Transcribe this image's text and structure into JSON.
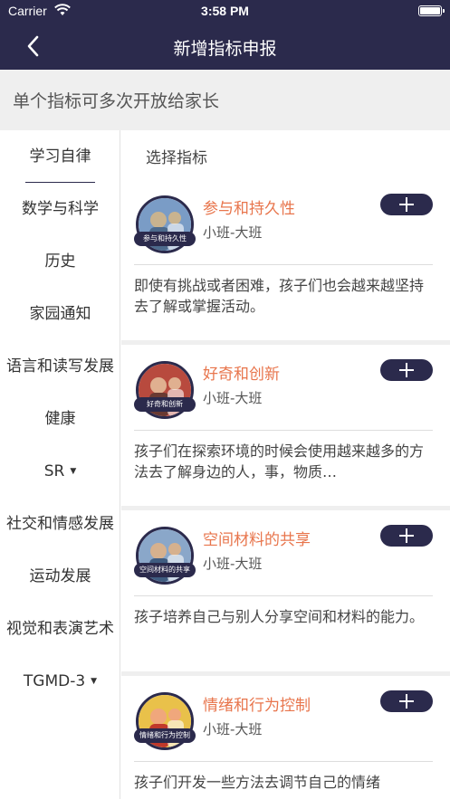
{
  "status_bar": {
    "carrier": "Carrier",
    "time": "3:58 PM"
  },
  "nav": {
    "title": "新增指标申报",
    "back_icon": "chevron-left-icon"
  },
  "notice": "单个指标可多次开放给家长",
  "sidebar": {
    "items": [
      {
        "label": "学习自律",
        "active": true,
        "dropdown": false
      },
      {
        "label": "数学与科学",
        "active": false,
        "dropdown": false
      },
      {
        "label": "历史",
        "active": false,
        "dropdown": false
      },
      {
        "label": "家园通知",
        "active": false,
        "dropdown": false
      },
      {
        "label": "语言和读写发展",
        "active": false,
        "dropdown": false
      },
      {
        "label": "健康",
        "active": false,
        "dropdown": false
      },
      {
        "label": "SR",
        "active": false,
        "dropdown": true
      },
      {
        "label": "社交和情感发展",
        "active": false,
        "dropdown": false
      },
      {
        "label": "运动发展",
        "active": false,
        "dropdown": false
      },
      {
        "label": "视觉和表演艺术",
        "active": false,
        "dropdown": false
      },
      {
        "label": "TGMD-3",
        "active": false,
        "dropdown": true
      }
    ],
    "dropdown_glyph": "▼"
  },
  "main": {
    "section_title": "选择指标",
    "cards": [
      {
        "name": "参与和持久性",
        "level": "小班-大班",
        "badge": "参与和持久性",
        "desc": "即使有挑战或者困难，孩子们也会越来越坚持去了解或掌握活动。"
      },
      {
        "name": "好奇和创新",
        "level": "小班-大班",
        "badge": "好奇和创新",
        "desc": "孩子们在探索环境的时候会使用越来越多的方法去了解身边的人，事，物质…"
      },
      {
        "name": "空间材料的共享",
        "level": "小班-大班",
        "badge": "空间材料的共享",
        "desc": "孩子培养自己与别人分享空间和材料的能力。"
      },
      {
        "name": "情绪和行为控制",
        "level": "小班-大班",
        "badge": "情绪和行为控制",
        "desc": "孩子们开发一些方法去调节自己的情绪"
      }
    ]
  },
  "colors": {
    "brand": "#2b2a4c",
    "accent": "#e8754c",
    "background": "#efefef"
  }
}
